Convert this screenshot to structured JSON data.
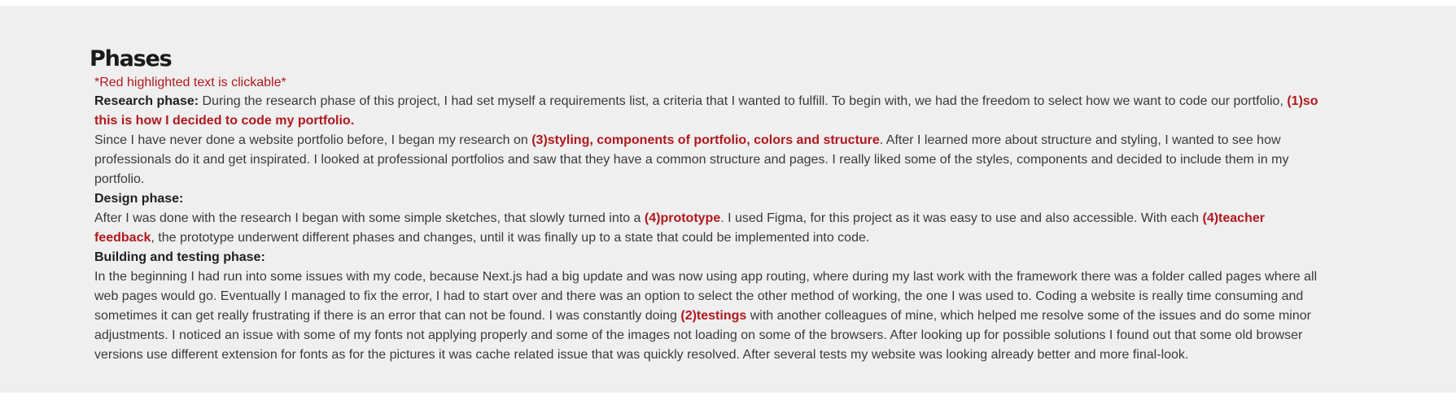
{
  "heading": "Phases",
  "note": "*Red highlighted text is clickable*",
  "research": {
    "label": "Research phase:",
    "text1": " During the research phase of this project, I had set myself a requirements list, a criteria that I wanted to fulfill. To begin with, we had the freedom to select how we want to code our portfolio, ",
    "link1": "(1)so this is how I decided to code my portfolio.",
    "text2": "Since I have never done a website portfolio before, I began my research on ",
    "link2": "(3)styling, components of portfolio, colors and structure",
    "text3": ". After I learned more about structure and styling, I wanted to see how professionals do it and get inspirated. I looked at professional portfolios and saw that they have a common structure and pages. I really liked some of the styles, components and decided to include them in my portfolio."
  },
  "design": {
    "label": "Design phase:",
    "text1": "After I was done with the research I began with some simple sketches, that slowly turned into a ",
    "link1": "(4)prototype",
    "text2": ". I used Figma, for this project as it was easy to use and also accessible. With each ",
    "link2": "(4)teacher feedback",
    "text3": ", the prototype underwent different phases and changes, until it was finally up to a state that could be implemented into code."
  },
  "building": {
    "label": "Building and testing phase:",
    "text1": "In the beginning I had run into some issues with my code, because Next.js had a big update and was now using app routing, where during my last work with the framework there was a folder called pages where all web pages would go. Eventually I managed to fix the error, I had to start over and there was an option to select the other method of working, the one I was used to. Coding a website is really time consuming and sometimes it can get really frustrating if there is an error that can not be found. I was constantly doing ",
    "link1": "(2)testings",
    "text2": " with another colleagues of mine, which helped me resolve some of the issues and do some minor adjustments. I noticed an issue with some of my fonts not applying properly and some of the images not loading on some of the browsers. After looking up for possible solutions I found out that some old browser versions use different extension for fonts as for the pictures it was cache related issue that was quickly resolved. After several tests my website was looking already better and more final-look."
  },
  "colors": {
    "background": "#efefef",
    "link": "#b0181e",
    "text": "#3a3a3a"
  }
}
